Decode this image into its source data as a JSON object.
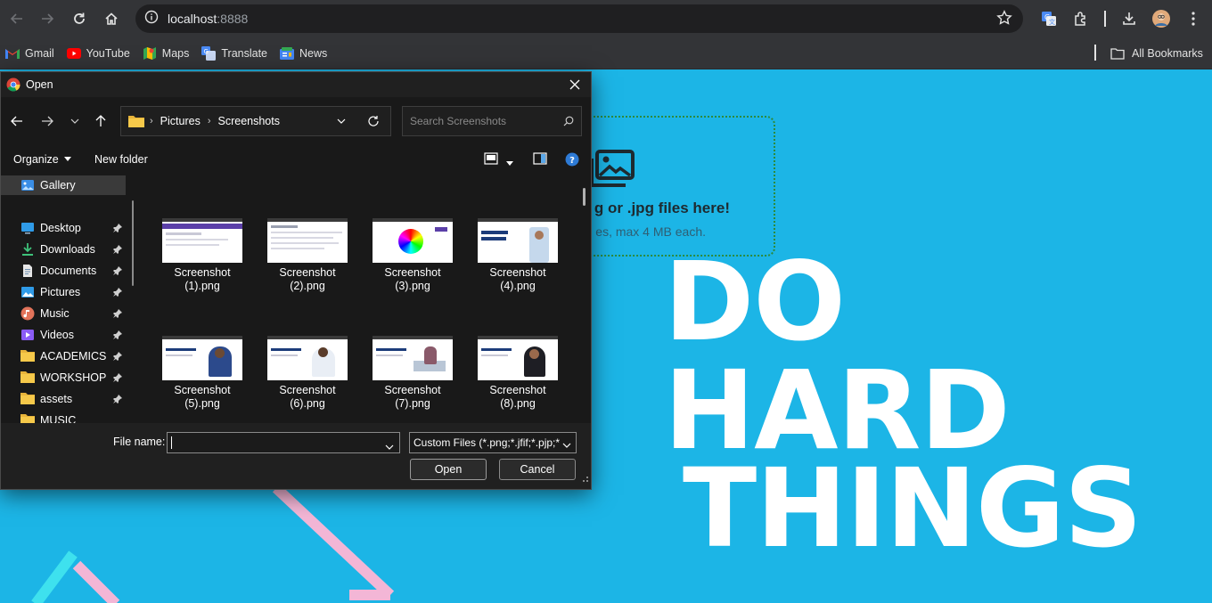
{
  "browser": {
    "url_host": "localhost",
    "url_port": ":8888",
    "bookmarks": [
      {
        "label": "Gmail",
        "icon": "gmail-icon"
      },
      {
        "label": "YouTube",
        "icon": "youtube-icon"
      },
      {
        "label": "Maps",
        "icon": "maps-icon"
      },
      {
        "label": "Translate",
        "icon": "translate-icon"
      },
      {
        "label": "News",
        "icon": "news-icon"
      }
    ],
    "all_bookmarks": "All Bookmarks"
  },
  "page": {
    "dropzone_title": "g or .jpg files here!",
    "dropzone_subtitle": "es, max 4 MB each.",
    "headline": [
      "DO",
      "HARD",
      "THINGS"
    ],
    "background_color": "#1cb5e6"
  },
  "dialog": {
    "title": "Open",
    "breadcrumb": [
      "Pictures",
      "Screenshots"
    ],
    "search_placeholder": "Search Screenshots",
    "organize": "Organize",
    "new_folder": "New folder",
    "nav_items": [
      {
        "label": "Gallery",
        "icon": "gallery-icon",
        "pinned": false,
        "selected": true
      },
      {
        "label": "Desktop",
        "icon": "desktop-icon",
        "pinned": true
      },
      {
        "label": "Downloads",
        "icon": "downloads-icon",
        "pinned": true
      },
      {
        "label": "Documents",
        "icon": "documents-icon",
        "pinned": true
      },
      {
        "label": "Pictures",
        "icon": "pictures-icon",
        "pinned": true
      },
      {
        "label": "Music",
        "icon": "music-icon",
        "pinned": true
      },
      {
        "label": "Videos",
        "icon": "videos-icon",
        "pinned": true
      },
      {
        "label": "ACADEMICS",
        "icon": "folder-icon",
        "pinned": true
      },
      {
        "label": "WORKSHOP",
        "icon": "folder-icon",
        "pinned": true
      },
      {
        "label": "assets",
        "icon": "folder-icon",
        "pinned": true
      },
      {
        "label": "MUSIC",
        "icon": "folder-icon",
        "pinned": false
      }
    ],
    "files": [
      {
        "line1": "Screenshot",
        "line2": "(1).png"
      },
      {
        "line1": "Screenshot",
        "line2": "(2).png"
      },
      {
        "line1": "Screenshot",
        "line2": "(3).png"
      },
      {
        "line1": "Screenshot",
        "line2": "(4).png"
      },
      {
        "line1": "Screenshot",
        "line2": "(5).png"
      },
      {
        "line1": "Screenshot",
        "line2": "(6).png"
      },
      {
        "line1": "Screenshot",
        "line2": "(7).png"
      },
      {
        "line1": "Screenshot",
        "line2": "(8).png"
      }
    ],
    "file_name_label": "File name:",
    "file_name_value": "",
    "file_type": "Custom Files (*.png;*.jfif;*.pjp;*",
    "open_button": "Open",
    "cancel_button": "Cancel"
  }
}
